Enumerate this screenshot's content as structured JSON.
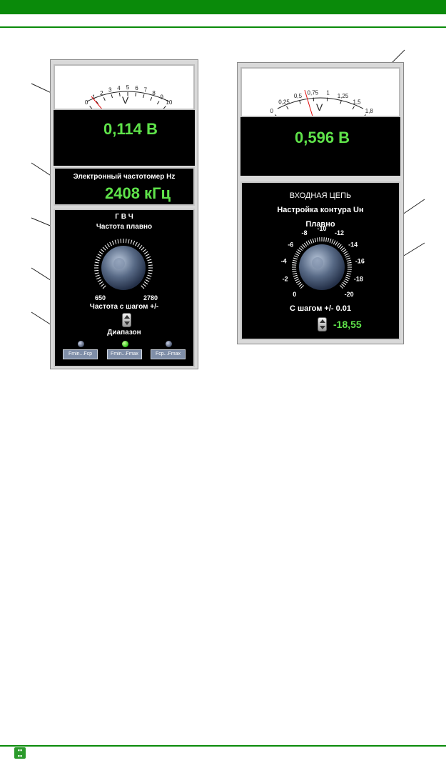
{
  "left_meter": {
    "scale_labels": [
      "0",
      "1",
      "2",
      "3",
      "4",
      "5",
      "6",
      "7",
      "8",
      "9",
      "10"
    ],
    "unit": "V",
    "reading": "0,114 В"
  },
  "frequency_counter": {
    "title": "Электронный частотомер Hz",
    "value": "2408 кГц"
  },
  "generator": {
    "title": "Г В Ч",
    "subtitle": "Частота плавно",
    "knob_min": "650",
    "knob_max": "2780",
    "step_label": "Частота с шагом +/-",
    "range_label": "Диапазон",
    "range_buttons": [
      "Fmin...Fср",
      "Fmin...Fmax",
      "Fср...Fmax"
    ]
  },
  "right_meter": {
    "scale_labels": [
      "0",
      "0,25",
      "0,5",
      "0,75",
      "1",
      "1,25",
      "1,5",
      "1,8"
    ],
    "unit": "V",
    "reading": "0,596 В"
  },
  "input_circuit": {
    "title": "ВХОДНАЯ ЦЕПЬ",
    "subtitle": "Настройка контура  Uн",
    "smooth_label": "Плавно",
    "dial_labels": [
      "0",
      "-2",
      "-4",
      "-6",
      "-8",
      "-10",
      "-12",
      "-14",
      "-16",
      "-18",
      "-20"
    ],
    "step_label": "С шагом +/- 0.01",
    "value": "-18,55"
  },
  "colors": {
    "accent_green": "#0a8a0a",
    "readout_green": "#5fe34a",
    "needle_red": "#e01010"
  }
}
